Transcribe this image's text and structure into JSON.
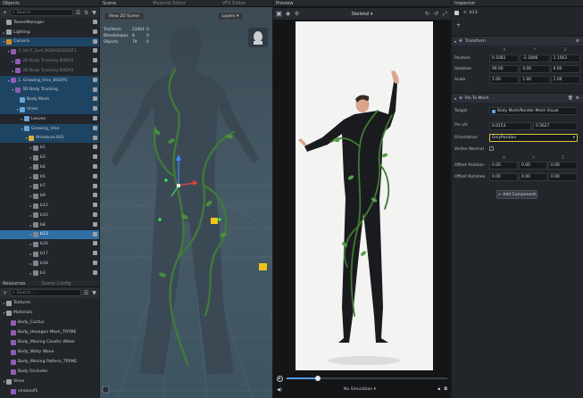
{
  "objects": {
    "title": "Objects",
    "search_placeholder": "Search...",
    "items": [
      {
        "label": "TweenManager",
        "depth": 0,
        "icon": "#9aa1a9",
        "chev": ""
      },
      {
        "label": "Lighting",
        "depth": 0,
        "icon": "#9aa1a9",
        "chev": "▸"
      },
      {
        "label": "Camera",
        "depth": 0,
        "icon": "#d08a2e",
        "chev": "▾",
        "state": "par"
      },
      {
        "label": "3_Art-F_Surf_BODYSEGEDIT1",
        "depth": 1,
        "icon": "#8e5db5",
        "chev": "▾",
        "dim": true
      },
      {
        "label": "3D Body Tracking BODY0",
        "depth": 2,
        "icon": "#8e5db5",
        "chev": "▸",
        "dim": true
      },
      {
        "label": "3D Body Tracking BODY0",
        "depth": 2,
        "icon": "#8e5db5",
        "chev": "▸",
        "dim": true
      },
      {
        "label": "1. Growing_Vine_BODY0",
        "depth": 1,
        "icon": "#8e5db5",
        "chev": "▾",
        "state": "par"
      },
      {
        "label": "3D Body Tracking",
        "depth": 2,
        "icon": "#8e5db5",
        "chev": "▾",
        "state": "par"
      },
      {
        "label": "Body Mesh",
        "depth": 3,
        "icon": "#6aa4d8",
        "chev": "",
        "state": "par"
      },
      {
        "label": "Vines",
        "depth": 3,
        "icon": "#6aa4d8",
        "chev": "▾",
        "state": "par"
      },
      {
        "label": "Leaves",
        "depth": 4,
        "icon": "#6aa4d8",
        "chev": "▸"
      },
      {
        "label": "Growing_Vine",
        "depth": 4,
        "icon": "#6aa4d8",
        "chev": "▾",
        "state": "par"
      },
      {
        "label": "Armature.001",
        "depth": 5,
        "icon": "#d9b13a",
        "chev": "▾",
        "state": "par"
      },
      {
        "label": "b1",
        "depth": 6,
        "icon": "#7f868e",
        "chev": "▸"
      },
      {
        "label": "b3",
        "depth": 6,
        "icon": "#7f868e",
        "chev": "▸"
      },
      {
        "label": "b4",
        "depth": 6,
        "icon": "#7f868e",
        "chev": "▸"
      },
      {
        "label": "b5",
        "depth": 6,
        "icon": "#7f868e",
        "chev": "▸"
      },
      {
        "label": "b7",
        "depth": 6,
        "icon": "#7f868e",
        "chev": "▸"
      },
      {
        "label": "b9",
        "depth": 6,
        "icon": "#7f868e",
        "chev": "▸"
      },
      {
        "label": "b12",
        "depth": 6,
        "icon": "#7f868e",
        "chev": "▸"
      },
      {
        "label": "b10",
        "depth": 6,
        "icon": "#7f868e",
        "chev": "▸"
      },
      {
        "label": "b8",
        "depth": 6,
        "icon": "#7f868e",
        "chev": "▸"
      },
      {
        "label": "b13",
        "depth": 6,
        "icon": "#7f868e",
        "chev": "▸",
        "state": "sel"
      },
      {
        "label": "b16",
        "depth": 6,
        "icon": "#7f868e",
        "chev": "▸"
      },
      {
        "label": "b17",
        "depth": 6,
        "icon": "#7f868e",
        "chev": "▸"
      },
      {
        "label": "b18",
        "depth": 6,
        "icon": "#7f868e",
        "chev": "▸"
      },
      {
        "label": "b3",
        "depth": 6,
        "icon": "#7f868e",
        "chev": "▸"
      }
    ]
  },
  "resources": {
    "title": "Resources",
    "tab2": "Scene Config",
    "search_placeholder": "Search...",
    "items": [
      {
        "label": "Textures",
        "depth": 0,
        "chev": "▸",
        "icon": "#9aa1a9"
      },
      {
        "label": "Materials",
        "depth": 0,
        "chev": "▾",
        "icon": "#9aa1a9"
      },
      {
        "label": "Body_Cactus",
        "depth": 1,
        "chev": "",
        "icon": "#8e5db5"
      },
      {
        "label": "Body_Hexagon Mesh_TRYME",
        "depth": 1,
        "chev": "",
        "icon": "#8e5db5"
      },
      {
        "label": "Body_Moving Caustic Water",
        "depth": 1,
        "chev": "",
        "icon": "#8e5db5"
      },
      {
        "label": "Body_Wally Wave",
        "depth": 1,
        "chev": "",
        "icon": "#8e5db5"
      },
      {
        "label": "Body_Moving Pattern_TRYME",
        "depth": 1,
        "chev": "",
        "icon": "#8e5db5"
      },
      {
        "label": "Body Occluder",
        "depth": 1,
        "chev": "",
        "icon": "#8e5db5"
      },
      {
        "label": "Vines",
        "depth": 0,
        "chev": "▾",
        "icon": "#9aa1a9"
      },
      {
        "label": "vineLeaf1",
        "depth": 1,
        "chev": "",
        "icon": "#8e5db5"
      }
    ]
  },
  "scene": {
    "title": "Scene",
    "tab_material": "Material Editor",
    "tab_vfx": "VFX Editor",
    "view_button": "View 2D Scene",
    "layers_label": "Layers",
    "stats": [
      {
        "label": "Tris/Verts",
        "value": "23463",
        "extra": "0"
      },
      {
        "label": "Blendshapes",
        "value": "8",
        "extra": "0"
      },
      {
        "label": "Objects",
        "value": "79",
        "extra": "0"
      }
    ]
  },
  "preview": {
    "title": "Preview",
    "mode": "Skeletal",
    "simulation": "No Simulation"
  },
  "inspector": {
    "title": "Inspector",
    "object_name": "b13",
    "transform": {
      "title": "Transform",
      "axes": [
        "X",
        "Y",
        "Z"
      ],
      "rows": [
        {
          "label": "Position",
          "values": [
            "0.1081",
            "-2.1806",
            "1.1563"
          ]
        },
        {
          "label": "Rotation",
          "values": [
            "90.00",
            "0.00",
            "0.00"
          ]
        },
        {
          "label": "Scale",
          "values": [
            "1.00",
            "1.00",
            "1.00"
          ]
        }
      ]
    },
    "pin": {
      "title": "Pin To Mesh",
      "target_label": "Target",
      "target_value": "Body Mesh/Render Mesh Visual",
      "pinuv_label": "Pin UV",
      "pinuv": [
        "0.0153",
        "0.5627"
      ],
      "orientation_label": "Orientation",
      "orientation_value": "OnlyPosition",
      "vertex_label": "Vertex Normal",
      "axes": [
        "X",
        "Y",
        "Z"
      ],
      "offset_pos_label": "Offset Position",
      "offset_pos": [
        "0.00",
        "0.00",
        "0.00"
      ],
      "offset_rot_label": "Offset Rotation",
      "offset_rot": [
        "0.00",
        "0.00",
        "0.00"
      ]
    },
    "add_component": "+ Add Component"
  }
}
